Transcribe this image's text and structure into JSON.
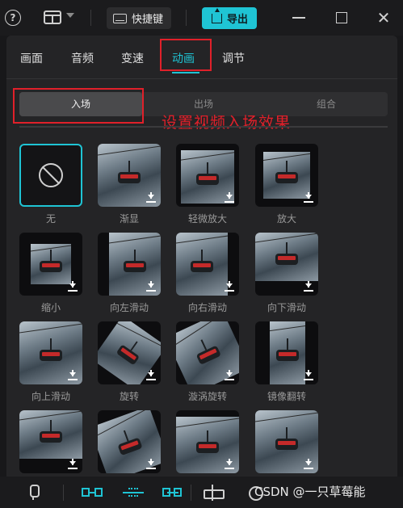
{
  "topbar": {
    "help_icon": "?",
    "shortcut_label": "快捷键",
    "export_label": "导出",
    "close_icon": "✕"
  },
  "main_tabs": [
    {
      "label": "画面",
      "active": false
    },
    {
      "label": "音频",
      "active": false
    },
    {
      "label": "变速",
      "active": false
    },
    {
      "label": "动画",
      "active": true
    },
    {
      "label": "调节",
      "active": false
    }
  ],
  "sub_tabs": [
    {
      "label": "入场",
      "active": true
    },
    {
      "label": "出场",
      "active": false
    },
    {
      "label": "组合",
      "active": false
    }
  ],
  "annotation": "设置视频入场效果",
  "effects": [
    {
      "label": "无",
      "selected": true,
      "icon": "none-icon"
    },
    {
      "label": "渐显",
      "download": true
    },
    {
      "label": "轻微放大",
      "download": true
    },
    {
      "label": "放大",
      "download": true
    },
    {
      "label": "缩小",
      "download": true
    },
    {
      "label": "向左滑动",
      "download": true
    },
    {
      "label": "向右滑动",
      "download": true
    },
    {
      "label": "向下滑动",
      "download": true
    },
    {
      "label": "向上滑动",
      "download": true
    },
    {
      "label": "旋转",
      "download": true
    },
    {
      "label": "漩涡旋转",
      "download": true
    },
    {
      "label": "镜像翻转",
      "download": true
    },
    {
      "label": "",
      "download": true
    },
    {
      "label": "",
      "download": true
    },
    {
      "label": "",
      "download": true
    },
    {
      "label": "",
      "download": true
    }
  ],
  "watermark": "CSDN @一只草莓能",
  "colors": {
    "accent": "#1fc4d4",
    "annotation_red": "#e0202a"
  }
}
